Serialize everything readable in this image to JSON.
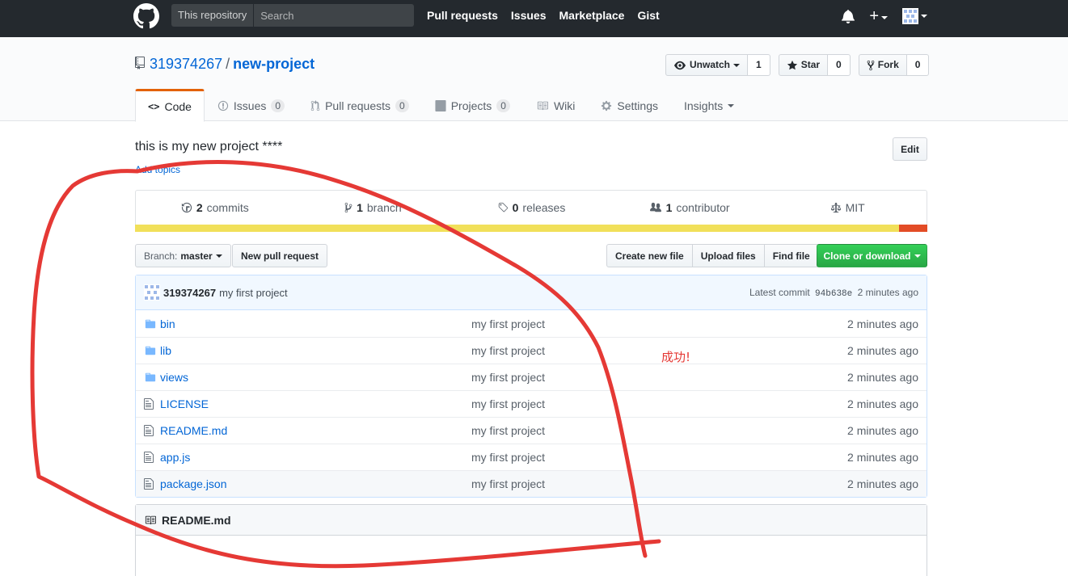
{
  "header": {
    "search_scope": "This repository",
    "search_placeholder": "Search",
    "nav": [
      "Pull requests",
      "Issues",
      "Marketplace",
      "Gist"
    ],
    "plus_symbol": "+"
  },
  "repo": {
    "owner": "319374267",
    "separator": "/",
    "name": "new-project",
    "watch_label": "Unwatch",
    "watch_count": "1",
    "star_label": "Star",
    "star_count": "0",
    "fork_label": "Fork",
    "fork_count": "0"
  },
  "tabs": {
    "code": "Code",
    "issues": "Issues",
    "issues_count": "0",
    "pulls": "Pull requests",
    "pulls_count": "0",
    "projects": "Projects",
    "projects_count": "0",
    "wiki": "Wiki",
    "settings": "Settings",
    "insights": "Insights"
  },
  "description": "this is my new project ****",
  "add_topics": "Add topics",
  "edit_label": "Edit",
  "summary": {
    "commits_n": "2",
    "commits_label": "commits",
    "branch_n": "1",
    "branch_label": "branch",
    "releases_n": "0",
    "releases_label": "releases",
    "contributor_n": "1",
    "contributor_label": "contributor",
    "license": "MIT"
  },
  "language_colors": {
    "primary": "#f1e05a",
    "secondary": "#e34c26"
  },
  "file_nav": {
    "branch_prefix": "Branch:",
    "branch_name": "master",
    "new_pr": "New pull request",
    "create_file": "Create new file",
    "upload": "Upload files",
    "find": "Find file",
    "clone": "Clone or download"
  },
  "commit": {
    "author": "319374267",
    "message": "my first project",
    "latest_label": "Latest commit",
    "sha": "94b638e",
    "age": "2 minutes ago"
  },
  "files": [
    {
      "type": "dir",
      "name": "bin",
      "message": "my first project",
      "age": "2 minutes ago"
    },
    {
      "type": "dir",
      "name": "lib",
      "message": "my first project",
      "age": "2 minutes ago"
    },
    {
      "type": "dir",
      "name": "views",
      "message": "my first project",
      "age": "2 minutes ago"
    },
    {
      "type": "file",
      "name": "LICENSE",
      "message": "my first project",
      "age": "2 minutes ago"
    },
    {
      "type": "file",
      "name": "README.md",
      "message": "my first project",
      "age": "2 minutes ago"
    },
    {
      "type": "file",
      "name": "app.js",
      "message": "my first project",
      "age": "2 minutes ago"
    },
    {
      "type": "file",
      "name": "package.json",
      "message": "my first project",
      "age": "2 minutes ago"
    }
  ],
  "readme_title": "README.md",
  "annotation": {
    "note": "成功!",
    "color": "#e53935"
  }
}
